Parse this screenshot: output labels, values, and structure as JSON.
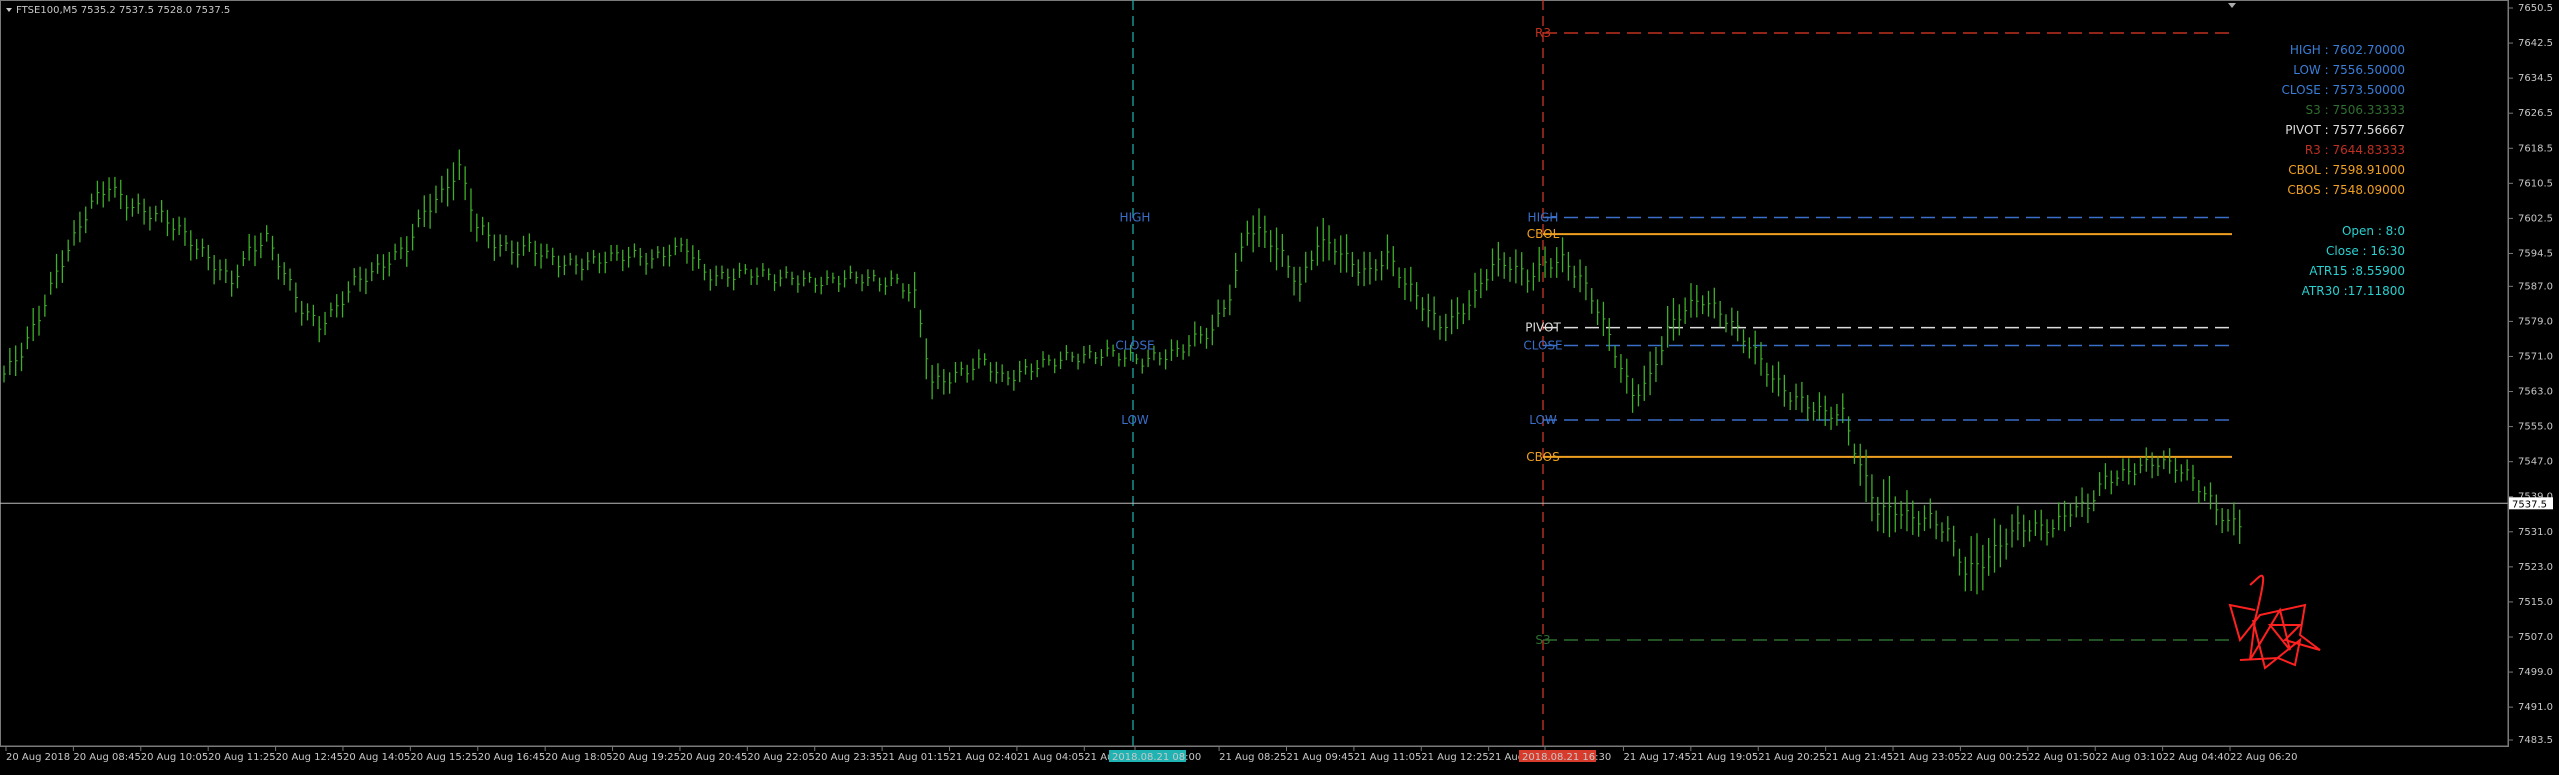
{
  "header": {
    "symbol_info": "FTSE100,M5  7535.2 7537.5 7528.0 7537.5"
  },
  "colors": {
    "background": "#000000",
    "candle": "#3fae2a",
    "axis_text": "#c8c8c8",
    "blue_line": "#3a6ec8",
    "day_separator_cyan": "#1fb3b3",
    "day_separator_red": "#d83b2b",
    "orange": "#f0a020",
    "white_dashed": "#dddddd",
    "r3": "#c03020",
    "s3": "#2f6f2f",
    "drawing_red": "#ff2020"
  },
  "chart_data": {
    "type": "candlestick",
    "title": "FTSE100,M5",
    "ylim": [
      7483.5,
      7650.5
    ],
    "y_ticks": [
      "7650.5",
      "7642.5",
      "7634.5",
      "7626.5",
      "7618.5",
      "7610.5",
      "7602.5",
      "7594.5",
      "7587.0",
      "7579.0",
      "7571.0",
      "7563.0",
      "7555.0",
      "7547.0",
      "7539.0",
      "7531.0",
      "7523.0",
      "7515.0",
      "7507.0",
      "7499.0",
      "7491.0",
      "7483.5"
    ],
    "x_ticks": [
      "20 Aug 2018",
      "20 Aug 08:45",
      "20 Aug 10:05",
      "20 Aug 11:25",
      "20 Aug 12:45",
      "20 Aug 14:05",
      "20 Aug 15:25",
      "20 Aug 16:45",
      "20 Aug 18:05",
      "20 Aug 19:25",
      "20 Aug 20:45",
      "20 Aug 22:05",
      "20 Aug 23:35",
      "21 Aug 01:15",
      "21 Aug 02:40",
      "21 Aug 04:05",
      "21 Aug 05:45",
      "2018.08.21 08:00",
      "21 Aug 08:25",
      "21 Aug 09:45",
      "21 Aug 11:05",
      "21 Aug 12:25",
      "21 Aug 13:45",
      "2018.08.21 16:30",
      "21 Aug 17:45",
      "21 Aug 19:05",
      "21 Aug 20:25",
      "21 Aug 21:45",
      "21 Aug 23:05",
      "22 Aug 00:25",
      "22 Aug 01:50",
      "22 Aug 03:10",
      "22 Aug 04:40",
      "22 Aug 06:20"
    ],
    "x_highlight_labels": [
      {
        "index": 17,
        "color": "#1fb3b3"
      },
      {
        "index": 23,
        "color": "#d83b2b"
      }
    ],
    "current_price": "7537.5",
    "close_series": [
      7567,
      7572,
      7580,
      7590,
      7598,
      7606,
      7610,
      7606,
      7604,
      7603,
      7600,
      7596,
      7592,
      7588,
      7595,
      7598,
      7590,
      7582,
      7578,
      7582,
      7588,
      7590,
      7593,
      7596,
      7604,
      7608,
      7614,
      7601,
      7597,
      7595,
      7596,
      7594,
      7592,
      7592,
      7593,
      7594,
      7594,
      7593,
      7595,
      7596,
      7590,
      7589,
      7590,
      7590,
      7589,
      7589,
      7588,
      7588,
      7589,
      7589,
      7588,
      7588,
      7585,
      7565,
      7566,
      7568,
      7570,
      7566,
      7567,
      7569,
      7570,
      7571,
      7571,
      7572,
      7571,
      7570,
      7571,
      7572,
      7575,
      7577,
      7585,
      7600,
      7599,
      7594,
      7587,
      7597,
      7596,
      7592,
      7590,
      7594,
      7588,
      7583,
      7578,
      7580,
      7585,
      7592,
      7592,
      7589,
      7592,
      7593,
      7589,
      7582,
      7572,
      7562,
      7566,
      7577,
      7582,
      7584,
      7581,
      7577,
      7572,
      7566,
      7562,
      7560,
      7558,
      7558,
      7546,
      7536,
      7536,
      7534,
      7534,
      7531,
      7522,
      7524,
      7528,
      7532,
      7532,
      7532,
      7536,
      7537,
      7543,
      7544,
      7546,
      7547,
      7546,
      7543,
      7538,
      7533
    ],
    "candle_ranges": [
      7,
      8,
      7,
      8,
      7,
      6,
      7,
      6,
      6,
      6,
      7,
      6,
      7,
      6,
      7,
      6,
      7,
      6,
      6,
      6,
      6,
      6,
      6,
      7,
      8,
      9,
      10,
      7,
      6,
      6,
      6,
      5,
      5,
      5,
      5,
      5,
      5,
      5,
      5,
      6,
      5,
      5,
      4,
      4,
      4,
      4,
      4,
      4,
      4,
      4,
      4,
      4,
      10,
      8,
      5,
      5,
      5,
      5,
      5,
      4,
      4,
      4,
      4,
      4,
      4,
      4,
      5,
      5,
      6,
      7,
      8,
      9,
      10,
      8,
      8,
      10,
      9,
      8,
      8,
      8,
      8,
      8,
      8,
      8,
      8,
      8,
      8,
      8,
      8,
      8,
      8,
      8,
      8,
      9,
      10,
      10,
      8,
      7,
      7,
      7,
      8,
      8,
      7,
      7,
      7,
      7,
      12,
      14,
      10,
      8,
      7,
      7,
      14,
      13,
      10,
      8,
      7,
      7,
      7,
      7,
      6,
      6,
      6,
      6,
      6,
      6,
      7,
      8
    ],
    "levels": [
      {
        "name": "R3",
        "label": "R3",
        "value": 7644.8,
        "color": "#c03020",
        "style": "dashed"
      },
      {
        "name": "HIGH",
        "label": "HIGH",
        "value": 7602.7,
        "color": "#3a6ec8",
        "style": "dashed"
      },
      {
        "name": "CBOL",
        "label": "CBOL",
        "value": 7598.9,
        "color": "#f0a020",
        "style": "solid"
      },
      {
        "name": "PIVOT",
        "label": "PIVOT",
        "value": 7577.57,
        "color": "#dddddd",
        "style": "dashed"
      },
      {
        "name": "CLOSE",
        "label": "CLOSE",
        "value": 7573.5,
        "color": "#3a6ec8",
        "style": "dashed"
      },
      {
        "name": "LOW",
        "label": "LOW",
        "value": 7556.5,
        "color": "#3a6ec8",
        "style": "dashed"
      },
      {
        "name": "CBOS",
        "label": "CBOS",
        "value": 7548.09,
        "color": "#f0a020",
        "style": "solid"
      },
      {
        "name": "S3",
        "label": "S3",
        "value": 7506.3,
        "color": "#2f6f2f",
        "style": "dashed"
      }
    ],
    "prev_day_labels": [
      {
        "label": "HIGH",
        "color": "#3a6ec8",
        "value": 7602.7
      },
      {
        "label": "CLOSE",
        "color": "#3a6ec8",
        "value": 7573.5
      },
      {
        "label": "LOW",
        "color": "#3a6ec8",
        "value": 7556.5
      }
    ]
  },
  "info_panel": {
    "lines": [
      {
        "text": "HIGH : 7602.70000",
        "color": "#3a7ed8"
      },
      {
        "text": "LOW : 7556.50000",
        "color": "#3a7ed8"
      },
      {
        "text": "CLOSE : 7573.50000",
        "color": "#3a7ed8"
      },
      {
        "text": "S3 : 7506.33333",
        "color": "#2f6f2f"
      },
      {
        "text": "PIVOT : 7577.56667",
        "color": "#dddddd"
      },
      {
        "text": "R3 : 7644.83333",
        "color": "#c03020"
      },
      {
        "text": "CBOL : 7598.91000",
        "color": "#f0a020"
      },
      {
        "text": "CBOS : 7548.09000",
        "color": "#f0a020"
      }
    ],
    "stats": [
      {
        "text": "Open : 8:0",
        "color": "#2ad0d0"
      },
      {
        "text": "Close : 16:30",
        "color": "#2ad0d0"
      },
      {
        "text": "ATR15 :8.55900",
        "color": "#2ad0d0"
      },
      {
        "text": "ATR30 :17.11800",
        "color": "#2ad0d0"
      }
    ]
  }
}
